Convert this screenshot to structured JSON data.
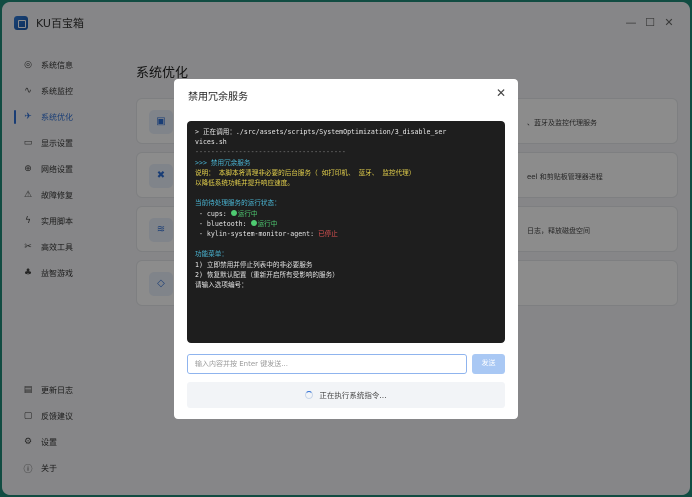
{
  "app": {
    "title": "KU百宝箱"
  },
  "window_controls": [
    "—",
    "☐",
    "✕"
  ],
  "sidebar": {
    "items": [
      {
        "label": "系统信息",
        "icon": "gauge-icon",
        "glyph": "◎"
      },
      {
        "label": "系统监控",
        "icon": "pulse-icon",
        "glyph": "∿"
      },
      {
        "label": "系统优化",
        "icon": "rocket-icon",
        "glyph": "✈",
        "active": true
      },
      {
        "label": "显示设置",
        "icon": "monitor-icon",
        "glyph": "▭"
      },
      {
        "label": "网络设置",
        "icon": "globe-icon",
        "glyph": "⊕"
      },
      {
        "label": "故障修复",
        "icon": "warning-icon",
        "glyph": "⚠"
      },
      {
        "label": "实用脚本",
        "icon": "lightning-icon",
        "glyph": "ϟ"
      },
      {
        "label": "高效工具",
        "icon": "tools-icon",
        "glyph": "✂"
      },
      {
        "label": "益智游戏",
        "icon": "gamepad-icon",
        "glyph": "♣"
      }
    ],
    "bottom": [
      {
        "label": "更新日志",
        "icon": "document-icon",
        "glyph": "▤"
      },
      {
        "label": "反馈建议",
        "icon": "chat-icon",
        "glyph": "▢"
      },
      {
        "label": "设置",
        "icon": "gear-icon",
        "glyph": "⚙"
      },
      {
        "label": "关于",
        "icon": "info-icon",
        "glyph": "ⓘ"
      }
    ]
  },
  "main": {
    "title": "系统优化",
    "cards": [
      {
        "icon": "chip-icon",
        "glyph": "▣",
        "desc": "、蓝牙及监控代理服务"
      },
      {
        "icon": "wrench-icon",
        "glyph": "✖",
        "desc": "eel 和剪贴板管理器进程"
      },
      {
        "icon": "wifi-icon",
        "glyph": "≋",
        "desc": "日志，释放磁盘空间"
      },
      {
        "icon": "box-icon",
        "glyph": "◇",
        "desc": ""
      }
    ]
  },
  "dialog": {
    "title": "禁用冗余服务",
    "close_glyph": "✕",
    "terminal": {
      "running_prefix": "> 正在调用：",
      "running_path_1": "./src/assets/scripts/SystemOptimization/3_disable_ser",
      "running_path_2": "vices.sh",
      "separator": "--------------------------------------",
      "header": ">>> 禁用冗余服务",
      "desc_1": "说明： 本脚本将清理非必要的后台服务（ 如打印机、 蓝牙、 监控代理）",
      "desc_2": "以降低系统功耗并提升响应速度。",
      "status_heading": "当前待处理服务的运行状态：",
      "svc_cups": " - cups: ",
      "svc_cups_state": "运行中",
      "svc_bt": " - bluetooth: ",
      "svc_bt_state": "运行中",
      "svc_kylin": " - kylin-system-monitor-agent: ",
      "svc_kylin_state": "已停止",
      "menu_heading": "功能菜单：",
      "menu_1": "1) 立即禁用并停止列表中的非必要服务",
      "menu_2": "2) 恢复默认配置（重新开启所有受影响的服务）",
      "prompt": "请输入选项编号："
    },
    "input_placeholder": "输入内容并按 Enter 键发送...",
    "send_label": "发送",
    "status_text": "正在执行系统指令..."
  },
  "colors": {
    "accent": "#2f6fd6",
    "terminal_bg": "#1e1e1e",
    "running": "#4ecb71",
    "stopped": "#e55454"
  }
}
